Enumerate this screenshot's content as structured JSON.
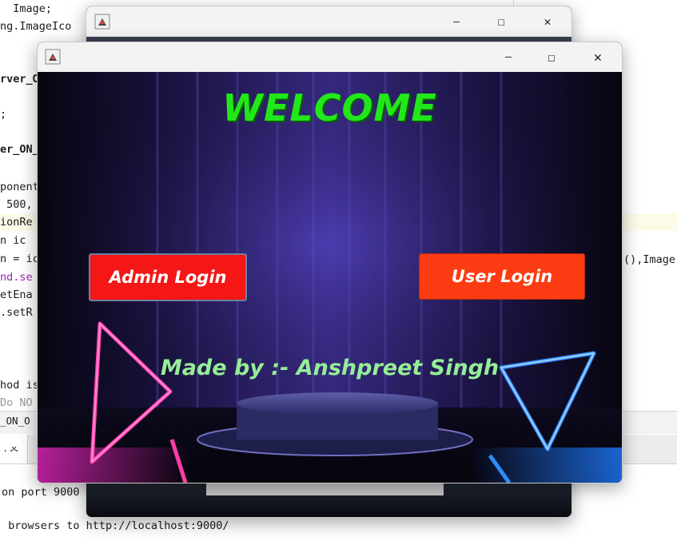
{
  "ide": {
    "code_lines": [
      "  Image;",
      "ng.ImageIco",
      "",
      "",
      "rver_O",
      "",
      ";",
      "",
      "er_ON_",
      "",
      "ponent",
      " 500,",
      "ionRe",
      "n ic",
      "n = ic",
      "nd.se",
      "etEna",
      ".setR",
      "",
      "",
      "hod is",
      "Do NO",
      "_ON_O"
    ],
    "right_code": "(),Image",
    "output_tab_label": "...",
    "output_tab_close": "✕",
    "output_lines": [
      "on port 9000",
      "",
      " browsers to http://localhost:9000/"
    ]
  },
  "back_window": {
    "minimize_glyph": "—",
    "maximize_glyph": "☐",
    "close_glyph": "✕",
    "app_icon": "java-cup-icon"
  },
  "front_window": {
    "app_icon": "java-cup-icon",
    "minimize_glyph": "—",
    "maximize_glyph": "☐",
    "close_glyph": "✕",
    "welcome_text": "WELCOME",
    "admin_button_label": "Admin Login",
    "user_button_label": "User Login",
    "credit_text": "Made by :- Anshpreet Singh"
  },
  "colors": {
    "welcome": "#22e81a",
    "admin_button": "#f51616",
    "user_button": "#fb3c13",
    "credit": "#95ee95"
  }
}
